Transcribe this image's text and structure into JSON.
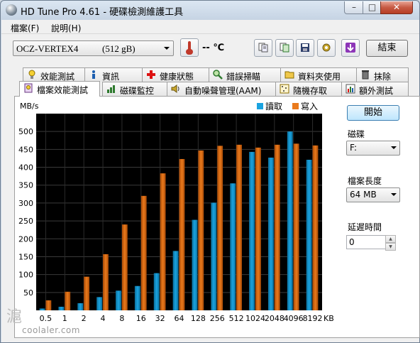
{
  "window": {
    "title": "HD Tune Pro 4.61 - 硬碟檢測維護工具",
    "min": "–",
    "max": "□",
    "close": "✕"
  },
  "menu": [
    {
      "label": "檔案(F)"
    },
    {
      "label": "說明(H)"
    }
  ],
  "toolbar": {
    "drive_name": "OCZ-VERTEX4",
    "drive_capacity": "(512 gB)",
    "temperature": "-- ℃",
    "exit_label": "結束",
    "icons": [
      "copy-text-icon",
      "copy-screen-icon",
      "save-icon",
      "settings-icon",
      "download-icon"
    ]
  },
  "tabs_row1": [
    {
      "label": "效能測試",
      "icon": "lightbulb-icon"
    },
    {
      "label": "資訊",
      "icon": "info-icon"
    },
    {
      "label": "健康狀態",
      "icon": "health-cross-icon"
    },
    {
      "label": "錯誤掃瞄",
      "icon": "magnifier-icon"
    },
    {
      "label": "資料夾使用",
      "icon": "folder-icon"
    },
    {
      "label": "抹除",
      "icon": "trash-icon"
    }
  ],
  "tabs_row2": [
    {
      "label": "檔案效能測試",
      "icon": "file-benchmark-icon",
      "active": true
    },
    {
      "label": "磁碟監控",
      "icon": "disk-monitor-icon"
    },
    {
      "label": "自動噪聲管理(AAM)",
      "icon": "speaker-icon"
    },
    {
      "label": "隨機存取",
      "icon": "random-access-icon"
    },
    {
      "label": "額外測試",
      "icon": "extra-tests-icon"
    }
  ],
  "side": {
    "start_label": "開始",
    "drive_label": "磁碟",
    "drive_value": "F:",
    "file_length_label": "檔案長度",
    "file_length_value": "64 MB",
    "delay_label": "延遲時間",
    "delay_value": "0"
  },
  "watermark": {
    "site": "coolaler.com"
  },
  "chart_data": {
    "type": "bar",
    "ylabel": "MB/s",
    "xlabel": "KB",
    "ylim": [
      0,
      550
    ],
    "yticks": [
      50,
      100,
      150,
      200,
      250,
      300,
      350,
      400,
      450,
      500
    ],
    "categories": [
      "0.5",
      "1",
      "2",
      "4",
      "8",
      "16",
      "32",
      "64",
      "128",
      "256",
      "512",
      "1024",
      "2048",
      "4096",
      "8192"
    ],
    "series": [
      {
        "name": "讀取",
        "color": "#1aa3e0",
        "values": [
          5,
          10,
          20,
          37,
          55,
          68,
          104,
          166,
          253,
          301,
          355,
          443,
          427,
          500,
          421
        ]
      },
      {
        "name": "寫入",
        "color": "#ea7a1c",
        "values": [
          28,
          52,
          94,
          157,
          240,
          320,
          383,
          423,
          447,
          460,
          463,
          455,
          463,
          466,
          461
        ]
      }
    ],
    "legend": "top-right",
    "grid": true
  }
}
